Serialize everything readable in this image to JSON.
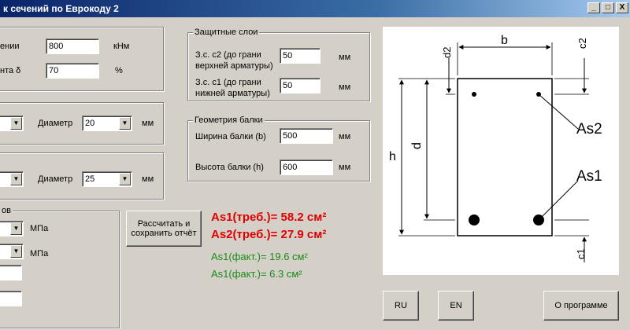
{
  "window": {
    "title": "к сечений по Еврокоду 2",
    "min": "_",
    "max": "□",
    "close": "X"
  },
  "moment": {
    "label": "ении",
    "value": "800",
    "unit": "кНм"
  },
  "coef": {
    "label": "нта δ",
    "value": "70",
    "unit": "%"
  },
  "rebar_top": {
    "diameter_label": "Диаметр",
    "diameter_value": "20",
    "unit": "мм"
  },
  "rebar_bottom": {
    "diameter_label": "Диаметр",
    "diameter_value": "25",
    "unit": "мм"
  },
  "materials": {
    "legend": "ов",
    "unit1": "МПа",
    "unit2": "МПа"
  },
  "covers": {
    "legend": "Защитные слои",
    "c2_label_line1": "З.с. c2 (до грани",
    "c2_label_line2": "верхней арматуры)",
    "c2_value": "50",
    "c2_unit": "мм",
    "c1_label_line1": "З.с. c1 (до грани",
    "c1_label_line2": "нижней арматуры)",
    "c1_value": "50",
    "c1_unit": "мм"
  },
  "geometry": {
    "legend": "Геометрия балки",
    "width_label": "Ширина балки (b)",
    "width_value": "500",
    "width_unit": "мм",
    "height_label": "Высота балки (h)",
    "height_value": "600",
    "height_unit": "мм"
  },
  "calc_button": {
    "line1": "Рассчитать и",
    "line2": "сохранить отчёт"
  },
  "results": {
    "as1_req": "As1(треб.)= 58.2 см²",
    "as2_req": "As2(треб.)= 27.9 см²",
    "as1_fact_a": "As1(факт.)= 19.6    см²",
    "as1_fact_b": "As1(факт.)= 6.3      см²"
  },
  "diagram": {
    "b": "b",
    "h": "h",
    "d": "d",
    "c2": "c2",
    "d2": "d2",
    "c1": "c1",
    "as1": "As1",
    "as2": "As2"
  },
  "buttons": {
    "ru": "RU",
    "en": "EN",
    "about": "О программе"
  },
  "colors": {
    "title_bar": "#0a246a",
    "required": "#e00000",
    "actual": "#1a8a1a",
    "face": "#d4d0c8"
  }
}
